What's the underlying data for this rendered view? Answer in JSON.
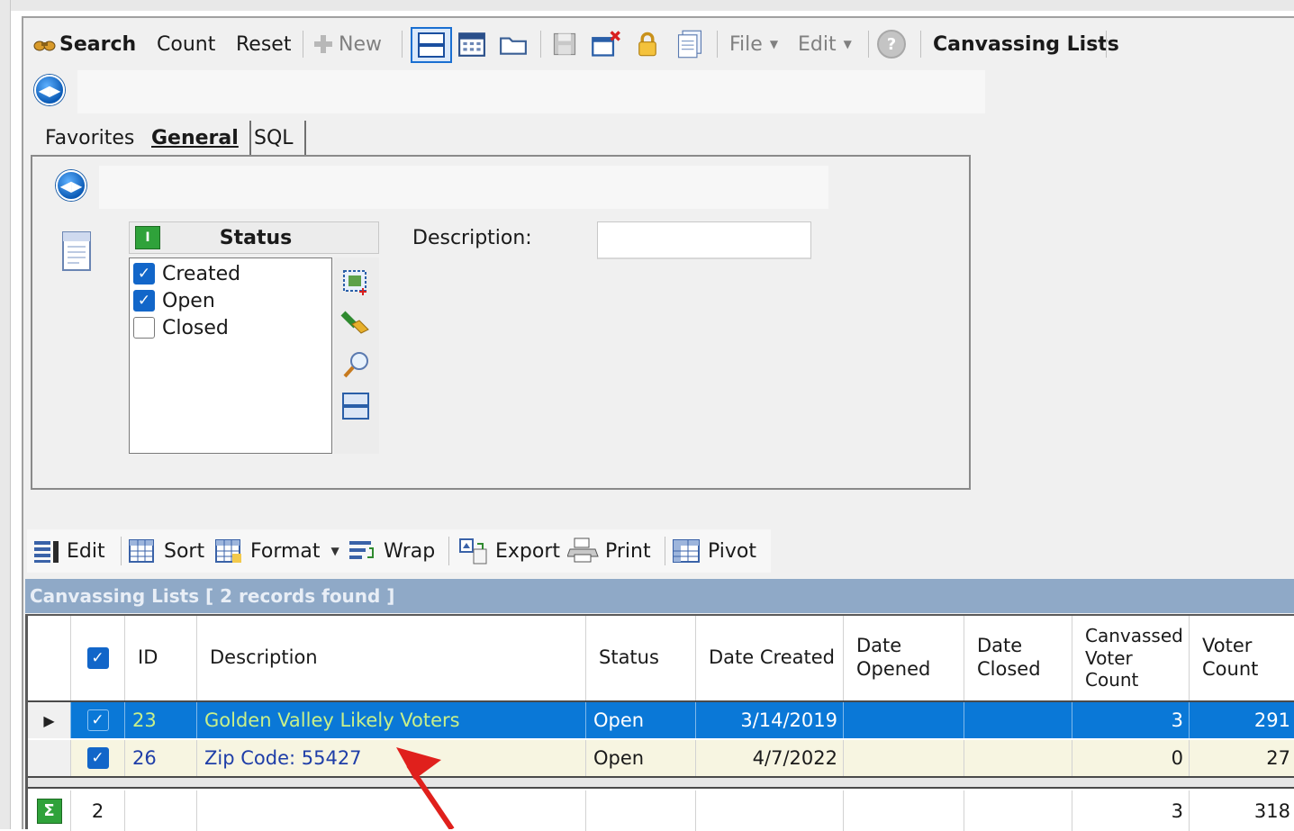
{
  "toolbar": {
    "search": "Search",
    "count": "Count",
    "reset": "Reset",
    "new": "New",
    "file": "File",
    "edit": "Edit",
    "title": "Canvassing Lists"
  },
  "tabs": [
    {
      "label": "Favorites"
    },
    {
      "label": "General"
    },
    {
      "label": "SQL"
    }
  ],
  "filter": {
    "status_header": "Status",
    "status_options": [
      {
        "label": "Created",
        "checked": true
      },
      {
        "label": "Open",
        "checked": true
      },
      {
        "label": "Closed",
        "checked": false
      }
    ],
    "description_label": "Description:",
    "description_value": ""
  },
  "grid_toolbar": {
    "edit": "Edit",
    "sort": "Sort",
    "format": "Format",
    "wrap": "Wrap",
    "export": "Export",
    "print": "Print",
    "pivot": "Pivot"
  },
  "grid": {
    "title": "Canvassing Lists [ 2 records found ]",
    "columns": [
      "ID",
      "Description",
      "Status",
      "Date Created",
      "Date Opened",
      "Date Closed",
      "Canvassed Voter Count",
      "Voter Count"
    ],
    "rows": [
      {
        "id": "23",
        "description": "Golden Valley Likely Voters",
        "status": "Open",
        "date_created": "3/14/2019",
        "date_opened": "",
        "date_closed": "",
        "canvassed": "3",
        "voter_count": "291"
      },
      {
        "id": "26",
        "description": "Zip Code: 55427",
        "status": "Open",
        "date_created": "4/7/2022",
        "date_opened": "",
        "date_closed": "",
        "canvassed": "0",
        "voter_count": "27"
      }
    ],
    "summary": {
      "count": "2",
      "canvassed": "3",
      "voter_count": "318"
    }
  },
  "colors": {
    "selection": "#0a78d7",
    "header_bar": "#8fa9c7",
    "alt_row": "#f7f5e1",
    "annotation_arrow": "#e0201c"
  }
}
